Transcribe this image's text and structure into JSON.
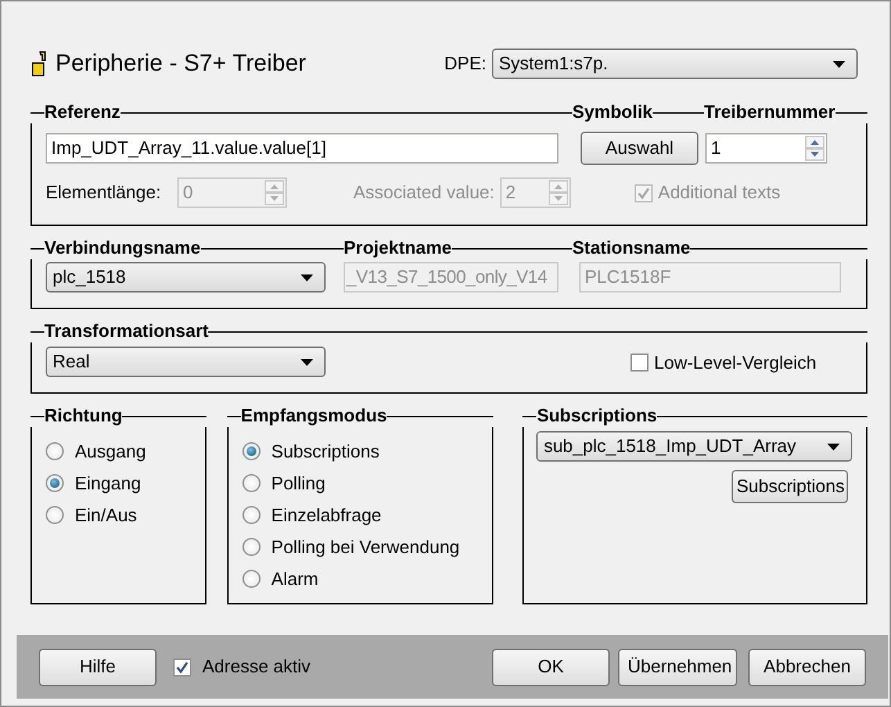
{
  "window": {
    "title": "Peripherie - S7+ Treiber"
  },
  "dpe": {
    "label": "DPE:",
    "value": "System1:s7p."
  },
  "referenz": {
    "legends": [
      "Referenz",
      "Symbolik",
      "Treibernummer"
    ],
    "reference": {
      "value": "Imp_UDT_Array_11.value.value[1]"
    },
    "auswahl_button": "Auswahl",
    "treibernummer": {
      "value": "1",
      "disabled": false
    },
    "elementlaenge": {
      "label": "Elementlänge:",
      "value": "0",
      "disabled": true
    },
    "associated_value": {
      "label": "Associated value:",
      "value": "2",
      "disabled": true
    },
    "additional_texts": {
      "label": "Additional texts",
      "checked": true,
      "disabled": true
    }
  },
  "verbindung": {
    "legends": [
      "Verbindungsname",
      "Projektname",
      "Stationsname"
    ],
    "connection": {
      "value": "plc_1518"
    },
    "project": {
      "value": "_V13_S7_1500_only_V14",
      "disabled": true
    },
    "station": {
      "value": "PLC1518F",
      "disabled": true
    }
  },
  "transformation": {
    "legend": "Transformationsart",
    "value": "Real",
    "low_level": {
      "label": "Low-Level-Vergleich",
      "checked": false,
      "disabled": false
    }
  },
  "richtung": {
    "legend": "Richtung",
    "options": [
      {
        "label": "Ausgang",
        "selected": false
      },
      {
        "label": "Eingang",
        "selected": true
      },
      {
        "label": "Ein/Aus",
        "selected": false
      }
    ]
  },
  "empfangsmodus": {
    "legend": "Empfangsmodus",
    "options": [
      {
        "label": "Subscriptions",
        "selected": true
      },
      {
        "label": "Polling",
        "selected": false
      },
      {
        "label": "Einzelabfrage",
        "selected": false
      },
      {
        "label": "Polling bei Verwendung",
        "selected": false
      },
      {
        "label": "Alarm",
        "selected": false
      }
    ]
  },
  "subscriptions": {
    "legend": "Subscriptions",
    "value": "sub_plc_1518_Imp_UDT_Array",
    "button": "Subscriptions"
  },
  "footer": {
    "help_button": "Hilfe",
    "adresse_aktiv": {
      "label": "Adresse aktiv",
      "checked": true,
      "disabled": false
    },
    "buttons": [
      "OK",
      "Übernehmen",
      "Abbrechen"
    ]
  }
}
